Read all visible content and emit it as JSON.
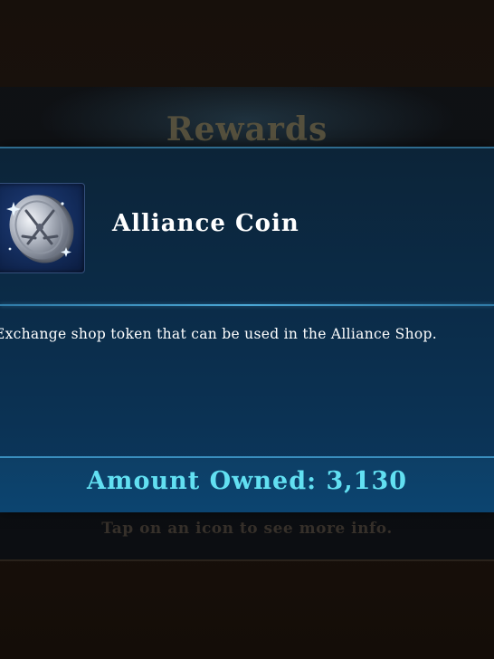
{
  "dialog": {
    "title": "Rewards",
    "hint": "Tap on an icon to see more info."
  },
  "item": {
    "name": "Alliance Coin",
    "icon": "alliance-coin-icon",
    "description": "Exchange shop token that can be used in the Alliance Shop.",
    "amount_label": "Amount Owned:",
    "amount_value": "3,130"
  },
  "colors": {
    "panel": "#0b2a45",
    "accent": "#62e0f2",
    "title_dim": "#55503d"
  }
}
